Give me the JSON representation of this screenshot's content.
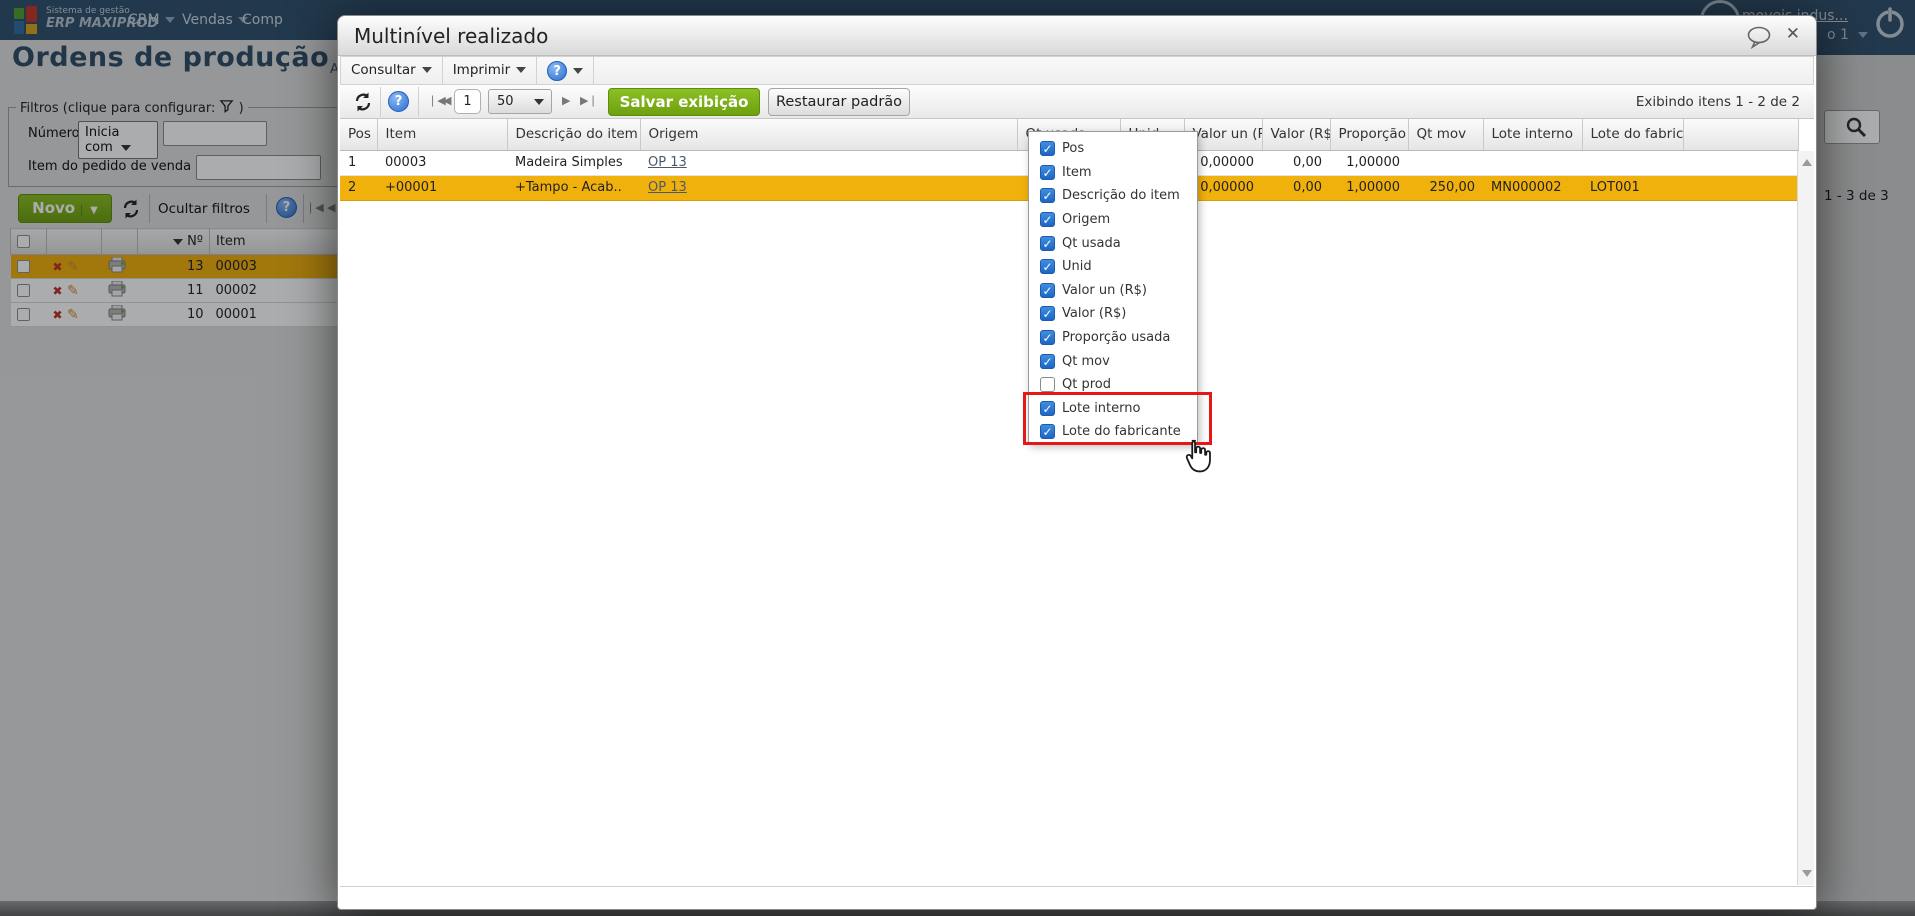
{
  "topbar": {
    "tagline": "Sistema de gestão",
    "brand": "ERP MAXIPROD",
    "menus": [
      {
        "label": "CRM",
        "arrow": true
      },
      {
        "label": "Vendas",
        "arrow": true
      },
      {
        "label": "Comp",
        "arrow": false
      }
    ],
    "company_link": "moveis indus...",
    "user_fragment": "o 1"
  },
  "left_page": {
    "title": "Ordens de produção",
    "title_fragment": "Ac",
    "filters": {
      "legend": "Filtros (clique para configurar:",
      "legend_close": ")",
      "field1_label": "Número",
      "field1_operator": "Inicia com",
      "field2_label": "Item do pedido de venda"
    },
    "toolbar": {
      "new_button": "Novo",
      "hide_filters": "Ocultar filtros"
    },
    "grid": {
      "col_number": "Nº",
      "col_item": "Item",
      "rows": [
        {
          "number": "13",
          "item": "00003",
          "selected": true
        },
        {
          "number": "11",
          "item": "00002",
          "selected": false
        },
        {
          "number": "10",
          "item": "00001",
          "selected": false
        }
      ]
    },
    "side_pagination": "1 - 3 de 3"
  },
  "modal": {
    "title": "Multinível realizado",
    "menus": [
      "Consultar",
      "Imprimir"
    ],
    "toolbar": {
      "page": "1",
      "page_size": "50",
      "save_button": "Salvar exibição",
      "restore_button": "Restaurar padrão",
      "items_info": "Exibindo itens 1 - 2 de 2"
    },
    "grid": {
      "columns": [
        "Pos",
        "Item",
        "Descrição do item",
        "Origem",
        "Qt usada",
        "Unid",
        "Valor un (R$)",
        "Valor (R$)",
        "Proporção usada",
        "Qt mov",
        "Lote interno",
        "Lote do fabricante"
      ],
      "rows": [
        {
          "selected": false,
          "cells": [
            "1",
            "00003",
            "Madeira Simples",
            "OP 13",
            "",
            "",
            "0,00000",
            "0,00",
            "1,00000",
            "",
            "",
            ""
          ]
        },
        {
          "selected": true,
          "cells": [
            "2",
            "+00001",
            "+Tampo - Acab..",
            "OP 13",
            "",
            "",
            "0,00000",
            "0,00",
            "1,00000",
            "250,00",
            "MN000002",
            "LOT001"
          ]
        }
      ]
    }
  },
  "column_menu": {
    "items": [
      {
        "label": "Pos",
        "checked": true
      },
      {
        "label": "Item",
        "checked": true
      },
      {
        "label": "Descrição do item",
        "checked": true
      },
      {
        "label": "Origem",
        "checked": true
      },
      {
        "label": "Qt usada",
        "checked": true
      },
      {
        "label": "Unid",
        "checked": true
      },
      {
        "label": "Valor un (R$)",
        "checked": true
      },
      {
        "label": "Valor (R$)",
        "checked": true
      },
      {
        "label": "Proporção usada",
        "checked": true
      },
      {
        "label": "Qt mov",
        "checked": true
      },
      {
        "label": "Qt prod",
        "checked": false
      },
      {
        "label": "Lote interno",
        "checked": true,
        "highlighted": true
      },
      {
        "label": "Lote do fabricante",
        "checked": true,
        "highlighted": true
      }
    ]
  },
  "colors": {
    "topbar_navy": "#30506c",
    "accent_green": "#76a312",
    "selection_orange": "#f1b10d",
    "checkbox_blue": "#2277d4",
    "annotation_red": "#e51717"
  }
}
